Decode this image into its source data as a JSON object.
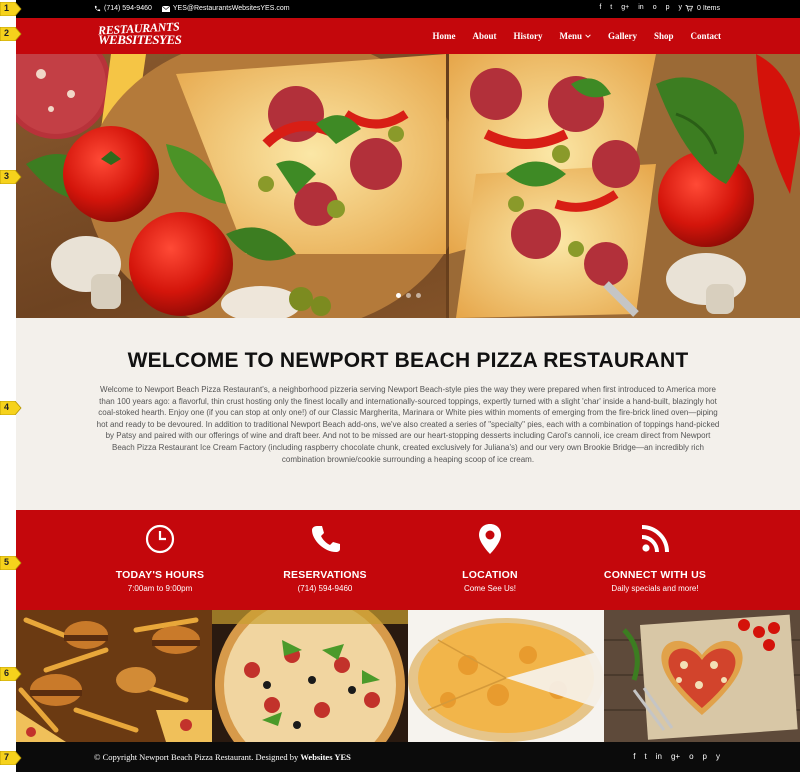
{
  "callouts": [
    "1",
    "2",
    "3",
    "4",
    "5",
    "6",
    "7"
  ],
  "topbar": {
    "phone": "(714) 594-9460",
    "email": "YES@RestaurantsWebsitesYES.com",
    "socials": [
      "f",
      "t",
      "g+",
      "in",
      "o",
      "p",
      "y"
    ],
    "cart_label": "0 Items"
  },
  "nav": {
    "logo_line1": "RESTAURANTS",
    "logo_line2": "WEBSITESYES",
    "items": [
      {
        "label": "Home"
      },
      {
        "label": "About"
      },
      {
        "label": "History"
      },
      {
        "label": "Menu"
      },
      {
        "label": "Gallery"
      },
      {
        "label": "Shop"
      },
      {
        "label": "Contact"
      }
    ]
  },
  "hero": {
    "slide_count": 3,
    "active_slide": 1
  },
  "welcome": {
    "title": "WELCOME TO NEWPORT BEACH PIZZA RESTAURANT",
    "body": "Welcome to Newport Beach Pizza Restaurant's, a neighborhood pizzeria serving Newport Beach-style pies the way they were prepared when first introduced to America more than 100 years ago:  a flavorful, thin crust hosting only the finest locally and internationally-sourced toppings, expertly turned with a slight 'char' inside a hand-built, blazingly hot coal-stoked hearth.  Enjoy one (if you can stop at only one!) of our Classic Margherita, Marinara or White pies within moments of emerging from the fire-brick lined oven—piping hot and ready to be devoured. In addition to traditional Newport Beach add-ons, we've also created a series of \"specialty\" pies, each with a combination of toppings hand-picked by Patsy and paired with our offerings of wine and draft beer. And not to be missed are our heart-stopping desserts including Carol's cannoli, ice cream direct from Newport Beach Pizza Restaurant Ice Cream Factory (including raspberry chocolate chunk, created exclusively for Juliana's) and our very own Brookie Bridge—an incredibly rich combination brownie/cookie surrounding a heaping scoop of ice cream."
  },
  "info": [
    {
      "icon": "clock-icon",
      "title": "TODAY'S HOURS",
      "sub": "7:00am to 9:00pm"
    },
    {
      "icon": "phone-icon",
      "title": "RESERVATIONS",
      "sub": "(714) 594-9460"
    },
    {
      "icon": "map-pin-icon",
      "title": "LOCATION",
      "sub": "Come See Us!"
    },
    {
      "icon": "rss-icon",
      "title": "CONNECT WITH US",
      "sub": "Daily specials and more!"
    }
  ],
  "footer": {
    "copyright": "© Copyright Newport Beach Pizza Restaurant. Designed by",
    "designer": "Websites YES",
    "socials": [
      "f",
      "t",
      "in",
      "g+",
      "o",
      "p",
      "y"
    ]
  },
  "colors": {
    "brand_red": "#c4070c",
    "topbar_black": "#000000",
    "welcome_bg": "#f3f0eb",
    "footer_black": "#0b0b0b"
  }
}
